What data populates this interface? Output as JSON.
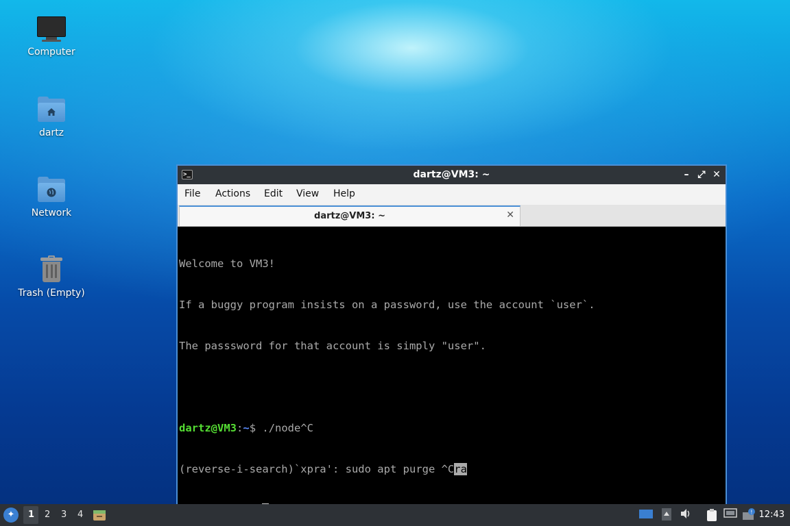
{
  "desktop": {
    "icons": [
      {
        "label": "Computer",
        "icon": "computer-icon"
      },
      {
        "label": "dartz",
        "icon": "home-folder-icon"
      },
      {
        "label": "Network",
        "icon": "network-folder-icon"
      },
      {
        "label": "Trash (Empty)",
        "icon": "trash-icon"
      }
    ]
  },
  "window": {
    "title": "dartz@VM3: ~",
    "controls": {
      "minimize": "–",
      "maximize": "⤢",
      "close": "✕"
    },
    "menu": [
      "File",
      "Actions",
      "Edit",
      "View",
      "Help"
    ],
    "tab": {
      "label": "dartz@VM3: ~",
      "close": "✕"
    },
    "terminal": {
      "motd": [
        "Welcome to VM3!",
        "If a buggy program insists on a password, use the account `user`.",
        "The passsword for that account is simply \"user\"."
      ],
      "prompt_user": "dartz@VM3",
      "prompt_sep": ":",
      "prompt_path": "~",
      "prompt_end": "$ ",
      "cmd1": "./node^C",
      "search_prefix": "(reverse-i-search)`xpra': sudo apt purge ^C",
      "search_match": "ra"
    }
  },
  "taskbar": {
    "workspaces": [
      "1",
      "2",
      "3",
      "4"
    ],
    "active_workspace": "1",
    "tray_icons": [
      "desktop-icon",
      "arrow-up-icon",
      "volume-icon",
      "clipboard-icon",
      "network-icon",
      "update-icon"
    ],
    "clock": "12:43"
  },
  "colors": {
    "prompt_user": "#55dd33",
    "prompt_path": "#5b8cff",
    "window_border": "#4a8fd6",
    "titlebar": "#2f3439"
  }
}
